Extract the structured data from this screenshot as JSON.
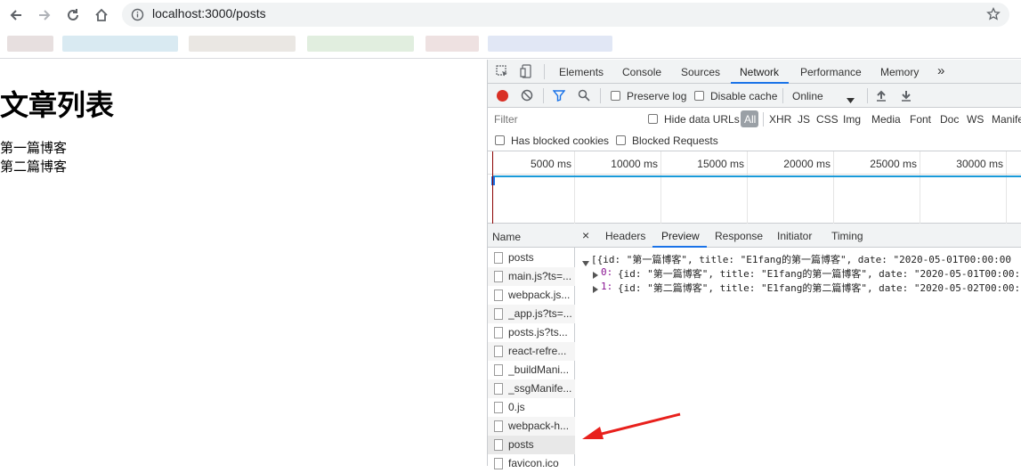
{
  "browser": {
    "url": "localhost:3000/posts"
  },
  "page": {
    "heading": "文章列表",
    "posts": [
      "第一篇博客",
      "第二篇博客"
    ]
  },
  "devtools": {
    "tabs": [
      "Elements",
      "Console",
      "Sources",
      "Network",
      "Performance",
      "Memory"
    ],
    "more_tabs": "»",
    "active_tab": "Network",
    "toolbar": {
      "preserve_log": "Preserve log",
      "disable_cache": "Disable cache",
      "throttle": "Online"
    },
    "filter": {
      "placeholder": "Filter",
      "hide_data_urls": "Hide data URLs",
      "types": [
        "All",
        "XHR",
        "JS",
        "CSS",
        "Img",
        "Media",
        "Font",
        "Doc",
        "WS",
        "Manife"
      ],
      "has_blocked_cookies": "Has blocked cookies",
      "blocked_requests": "Blocked Requests"
    },
    "timeline_ticks": [
      "5000 ms",
      "10000 ms",
      "15000 ms",
      "20000 ms",
      "25000 ms",
      "30000 ms"
    ],
    "name_header": "Name",
    "requests": [
      "posts",
      "main.js?ts=...",
      "webpack.js...",
      "_app.js?ts=...",
      "posts.js?ts...",
      "react-refre...",
      "_buildMani...",
      "_ssgManife...",
      "0.js",
      "webpack-h...",
      "posts",
      "favicon.ico"
    ],
    "detail_tabs": [
      "Headers",
      "Preview",
      "Response",
      "Initiator",
      "Timing"
    ],
    "close_symbol": "×",
    "active_detail_tab": "Preview",
    "preview": {
      "summary": "[{id: \"第一篇博客\", title: \"E1fang的第一篇博客\", date: \"2020-05-01T00:00:00",
      "item0_key": "0:",
      "item0": "{id: \"第一篇博客\", title: \"E1fang的第一篇博客\", date: \"2020-05-01T00:00:",
      "item1_key": "1:",
      "item1": "{id: \"第二篇博客\", title: \"E1fang的第二篇博客\", date: \"2020-05-02T00:00:"
    }
  },
  "colors": {
    "accent": "#1a73e8",
    "record": "#d93025",
    "arrow": "#e8201c",
    "key_purple": "#881391"
  }
}
